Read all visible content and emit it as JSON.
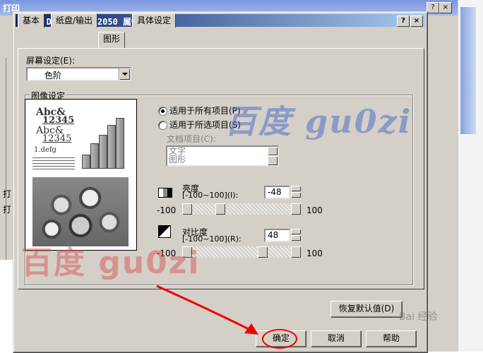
{
  "background_window": {
    "title": "打印",
    "fragments": [
      "打",
      "打"
    ],
    "help_btn": "?",
    "close_btn": "×"
  },
  "dialog": {
    "title": "FX DocuPrint 2050 属性",
    "help_btn": "?",
    "close_btn": "×",
    "tabs": [
      {
        "label": "基本",
        "active": false
      },
      {
        "label": "纸盘/输出",
        "active": false
      },
      {
        "label": "图形",
        "active": true
      },
      {
        "label": "具体设定",
        "active": false
      }
    ],
    "screen_setting": {
      "label": "屏幕设定(E):",
      "value": "色阶"
    },
    "image_setting": {
      "group_label": "图像设定",
      "radio_all": "适用于所有项目(P)",
      "radio_selected": "适用于所选项目(S)",
      "doc_items_label": "文档项目(C):",
      "doc_items": [
        "文字",
        "图形"
      ],
      "preview": {
        "line1": "Abc&",
        "line2": "12345",
        "line3": "Abc&",
        "line4": "12345",
        "line5": "1.defg"
      },
      "brightness": {
        "label": "亮度",
        "range_label": "[-100~100](I):",
        "value": "-48",
        "min": "-100",
        "max": "100",
        "level": -48
      },
      "contrast": {
        "label": "对比度",
        "range_label": "[-100~100](R):",
        "value": "48",
        "min": "-100",
        "max": "100",
        "level": 48
      }
    },
    "buttons": {
      "restore_defaults": "恢复默认值(D)",
      "ok": "确定",
      "cancel": "取消",
      "help": "帮助"
    }
  },
  "watermarks": {
    "blue": "百度 gu0zi",
    "red": "百度 gu0zi",
    "baidu": "Bai 经验"
  },
  "colors": {
    "dialog_face": "#d4d0c8",
    "title_active": "#0a246a",
    "annotation_red": "#ee0000"
  }
}
